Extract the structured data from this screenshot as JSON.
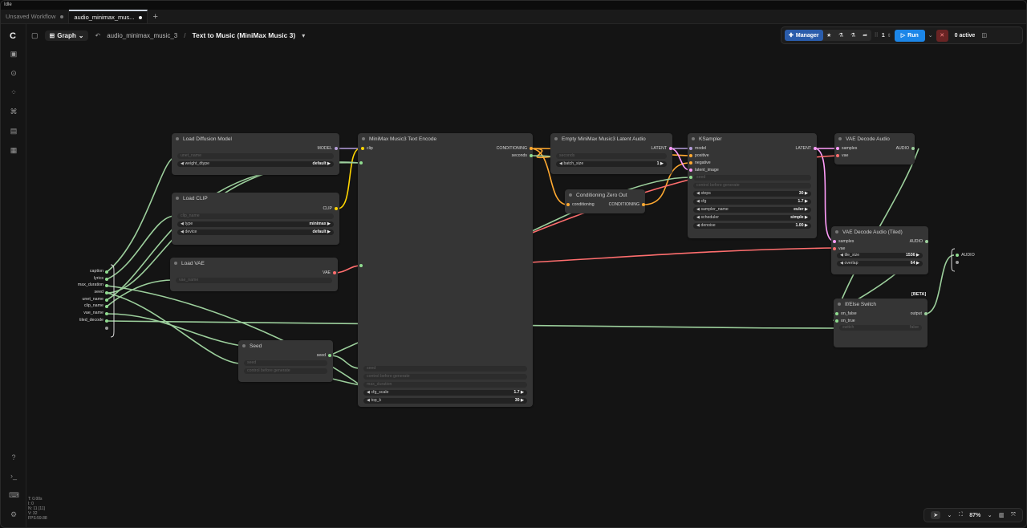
{
  "status_text": "Idle",
  "tabs": [
    {
      "label": "Unsaved Workflow",
      "active": false
    },
    {
      "label": "audio_minimax_mus...",
      "active": true
    }
  ],
  "toolbar": {
    "graph_label": "Graph",
    "breadcrumb_file": "audio_minimax_music_3",
    "breadcrumb_sep": "/",
    "workflow_title": "Text to Music (MiniMax Music 3)",
    "manager_label": "Manager",
    "queue_count": "1",
    "run_label": "Run",
    "active_label": "0 active"
  },
  "nodes": {
    "load_diffusion": {
      "title": "Load Diffusion Model",
      "out_model": "MODEL",
      "w_unet": "unet_name",
      "w_dtype": "weight_dtype",
      "w_dtype_val": "default"
    },
    "load_clip": {
      "title": "Load CLIP",
      "out_clip": "CLIP",
      "w_clip": "clip_name",
      "w_type": "type",
      "w_type_val": "minimax",
      "w_device": "device",
      "w_device_val": "default"
    },
    "load_vae": {
      "title": "Load VAE",
      "out_vae": "VAE",
      "w_vae": "vae_name"
    },
    "seed": {
      "title": "Seed",
      "out_seed": "seed",
      "w_seed": "seed",
      "w_ctrl": "control before generate"
    },
    "text_encode": {
      "title": "MiniMax Music3 Text Encode",
      "in_clip": "clip",
      "out_cond": "CONDITIONING",
      "out_seconds": "seconds",
      "w_seed": "seed",
      "w_ctrl": "control before generate",
      "w_max": "max_duration",
      "w_cfg": "cfg_scale",
      "w_cfg_val": "1.7",
      "w_topk": "top_k",
      "w_topk_val": "30"
    },
    "empty_latent": {
      "title": "Empty MiniMax Music3 Latent Audio",
      "out_latent": "LATENT",
      "w_seconds": "seconds",
      "w_batch": "batch_size",
      "w_batch_val": "1"
    },
    "cond_zero": {
      "title": "Conditioning Zero Out",
      "in_cond": "conditioning",
      "out_cond": "CONDITIONING"
    },
    "ksampler": {
      "title": "KSampler",
      "in_model": "model",
      "in_pos": "positive",
      "in_neg": "negative",
      "in_latent": "latent_image",
      "out_latent": "LATENT",
      "w_seed": "seed",
      "w_ctrl": "control before generate",
      "w_steps": "steps",
      "w_steps_val": "30",
      "w_cfg": "cfg",
      "w_cfg_val": "1.7",
      "w_sampler": "sampler_name",
      "w_sampler_val": "euler",
      "w_sched": "scheduler",
      "w_sched_val": "simple",
      "w_denoise": "denoise",
      "w_denoise_val": "1.00"
    },
    "vae_decode": {
      "title": "VAE Decode Audio",
      "in_samples": "samples",
      "in_vae": "vae",
      "out_audio": "AUDIO"
    },
    "vae_decode_tiled": {
      "title": "VAE Decode Audio (Tiled)",
      "in_samples": "samples",
      "in_vae": "vae",
      "out_audio": "AUDIO",
      "w_tile": "tile_size",
      "w_tile_val": "1536",
      "w_overlap": "overlap",
      "w_overlap_val": "64"
    },
    "if_else": {
      "title": "If/Else Switch",
      "badge": "[BETA]",
      "in_false": "on_false",
      "in_true": "on_true",
      "out": "output",
      "w_switch": "switch",
      "w_switch_val": "false"
    }
  },
  "group_inputs": [
    "caption",
    "lyrics",
    "max_duration",
    "seed",
    "unet_name",
    "clip_name",
    "vae_name",
    "tiled_decode"
  ],
  "group_output": "AUDIO",
  "perf": [
    "T: 0.00s",
    "I: 0",
    "N: 11 [11]",
    "V: 32",
    "FPS:59.88"
  ],
  "zoom": "87%",
  "colors": {
    "model": "#b39ddb",
    "clip": "#ffd500",
    "vae": "#ff6e6e",
    "conditioning": "#ffa931",
    "latent": "#ff9cf9",
    "audio": "#9ccf9c",
    "generic": "#8fdc8f"
  }
}
